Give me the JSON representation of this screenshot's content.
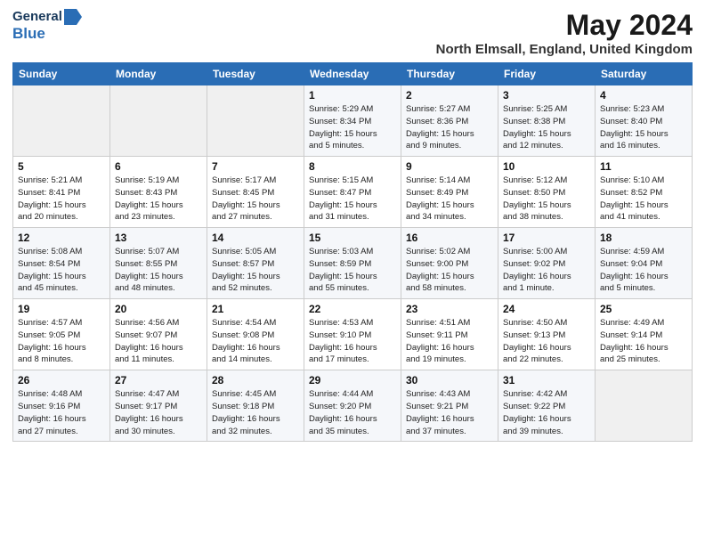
{
  "logo": {
    "line1": "General",
    "line2": "Blue"
  },
  "title": {
    "month_year": "May 2024",
    "location": "North Elmsall, England, United Kingdom"
  },
  "days_of_week": [
    "Sunday",
    "Monday",
    "Tuesday",
    "Wednesday",
    "Thursday",
    "Friday",
    "Saturday"
  ],
  "weeks": [
    [
      {
        "day": "",
        "info": ""
      },
      {
        "day": "",
        "info": ""
      },
      {
        "day": "",
        "info": ""
      },
      {
        "day": "1",
        "info": "Sunrise: 5:29 AM\nSunset: 8:34 PM\nDaylight: 15 hours\nand 5 minutes."
      },
      {
        "day": "2",
        "info": "Sunrise: 5:27 AM\nSunset: 8:36 PM\nDaylight: 15 hours\nand 9 minutes."
      },
      {
        "day": "3",
        "info": "Sunrise: 5:25 AM\nSunset: 8:38 PM\nDaylight: 15 hours\nand 12 minutes."
      },
      {
        "day": "4",
        "info": "Sunrise: 5:23 AM\nSunset: 8:40 PM\nDaylight: 15 hours\nand 16 minutes."
      }
    ],
    [
      {
        "day": "5",
        "info": "Sunrise: 5:21 AM\nSunset: 8:41 PM\nDaylight: 15 hours\nand 20 minutes."
      },
      {
        "day": "6",
        "info": "Sunrise: 5:19 AM\nSunset: 8:43 PM\nDaylight: 15 hours\nand 23 minutes."
      },
      {
        "day": "7",
        "info": "Sunrise: 5:17 AM\nSunset: 8:45 PM\nDaylight: 15 hours\nand 27 minutes."
      },
      {
        "day": "8",
        "info": "Sunrise: 5:15 AM\nSunset: 8:47 PM\nDaylight: 15 hours\nand 31 minutes."
      },
      {
        "day": "9",
        "info": "Sunrise: 5:14 AM\nSunset: 8:49 PM\nDaylight: 15 hours\nand 34 minutes."
      },
      {
        "day": "10",
        "info": "Sunrise: 5:12 AM\nSunset: 8:50 PM\nDaylight: 15 hours\nand 38 minutes."
      },
      {
        "day": "11",
        "info": "Sunrise: 5:10 AM\nSunset: 8:52 PM\nDaylight: 15 hours\nand 41 minutes."
      }
    ],
    [
      {
        "day": "12",
        "info": "Sunrise: 5:08 AM\nSunset: 8:54 PM\nDaylight: 15 hours\nand 45 minutes."
      },
      {
        "day": "13",
        "info": "Sunrise: 5:07 AM\nSunset: 8:55 PM\nDaylight: 15 hours\nand 48 minutes."
      },
      {
        "day": "14",
        "info": "Sunrise: 5:05 AM\nSunset: 8:57 PM\nDaylight: 15 hours\nand 52 minutes."
      },
      {
        "day": "15",
        "info": "Sunrise: 5:03 AM\nSunset: 8:59 PM\nDaylight: 15 hours\nand 55 minutes."
      },
      {
        "day": "16",
        "info": "Sunrise: 5:02 AM\nSunset: 9:00 PM\nDaylight: 15 hours\nand 58 minutes."
      },
      {
        "day": "17",
        "info": "Sunrise: 5:00 AM\nSunset: 9:02 PM\nDaylight: 16 hours\nand 1 minute."
      },
      {
        "day": "18",
        "info": "Sunrise: 4:59 AM\nSunset: 9:04 PM\nDaylight: 16 hours\nand 5 minutes."
      }
    ],
    [
      {
        "day": "19",
        "info": "Sunrise: 4:57 AM\nSunset: 9:05 PM\nDaylight: 16 hours\nand 8 minutes."
      },
      {
        "day": "20",
        "info": "Sunrise: 4:56 AM\nSunset: 9:07 PM\nDaylight: 16 hours\nand 11 minutes."
      },
      {
        "day": "21",
        "info": "Sunrise: 4:54 AM\nSunset: 9:08 PM\nDaylight: 16 hours\nand 14 minutes."
      },
      {
        "day": "22",
        "info": "Sunrise: 4:53 AM\nSunset: 9:10 PM\nDaylight: 16 hours\nand 17 minutes."
      },
      {
        "day": "23",
        "info": "Sunrise: 4:51 AM\nSunset: 9:11 PM\nDaylight: 16 hours\nand 19 minutes."
      },
      {
        "day": "24",
        "info": "Sunrise: 4:50 AM\nSunset: 9:13 PM\nDaylight: 16 hours\nand 22 minutes."
      },
      {
        "day": "25",
        "info": "Sunrise: 4:49 AM\nSunset: 9:14 PM\nDaylight: 16 hours\nand 25 minutes."
      }
    ],
    [
      {
        "day": "26",
        "info": "Sunrise: 4:48 AM\nSunset: 9:16 PM\nDaylight: 16 hours\nand 27 minutes."
      },
      {
        "day": "27",
        "info": "Sunrise: 4:47 AM\nSunset: 9:17 PM\nDaylight: 16 hours\nand 30 minutes."
      },
      {
        "day": "28",
        "info": "Sunrise: 4:45 AM\nSunset: 9:18 PM\nDaylight: 16 hours\nand 32 minutes."
      },
      {
        "day": "29",
        "info": "Sunrise: 4:44 AM\nSunset: 9:20 PM\nDaylight: 16 hours\nand 35 minutes."
      },
      {
        "day": "30",
        "info": "Sunrise: 4:43 AM\nSunset: 9:21 PM\nDaylight: 16 hours\nand 37 minutes."
      },
      {
        "day": "31",
        "info": "Sunrise: 4:42 AM\nSunset: 9:22 PM\nDaylight: 16 hours\nand 39 minutes."
      },
      {
        "day": "",
        "info": ""
      }
    ]
  ]
}
